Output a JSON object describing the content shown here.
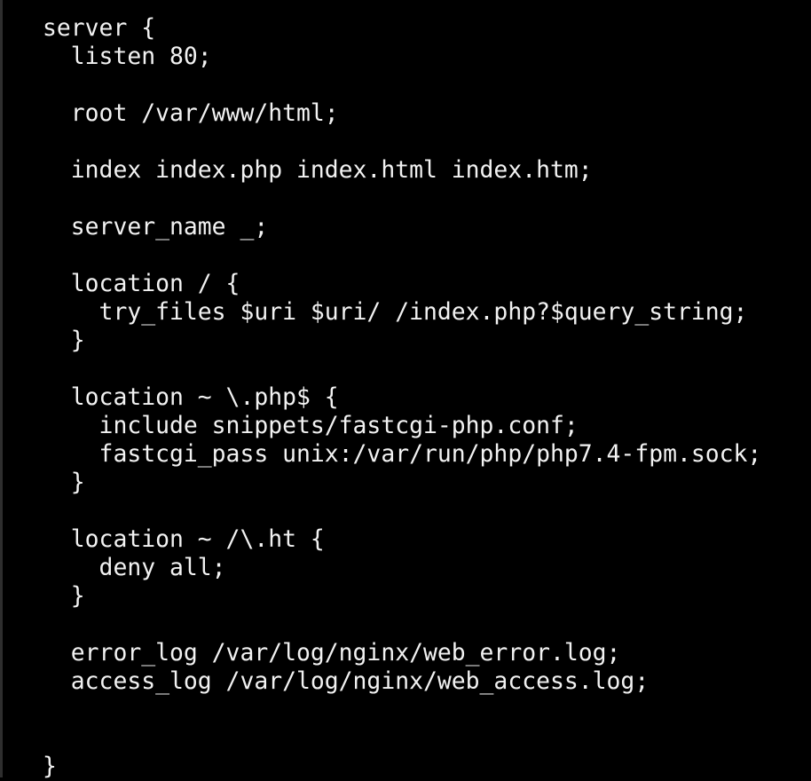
{
  "terminal": {
    "lines": [
      "server {",
      "  listen 80;",
      "",
      "  root /var/www/html;",
      "",
      "  index index.php index.html index.htm;",
      "",
      "  server_name _;",
      "",
      "  location / {",
      "    try_files $uri $uri/ /index.php?$query_string;",
      "  }",
      "",
      "  location ~ \\.php$ {",
      "    include snippets/fastcgi-php.conf;",
      "    fastcgi_pass unix:/var/run/php/php7.4-fpm.sock;",
      "  }",
      "",
      "  location ~ /\\.ht {",
      "    deny all;",
      "  }",
      "",
      "  error_log /var/log/nginx/web_error.log;",
      "  access_log /var/log/nginx/web_access.log;",
      "",
      "",
      "}"
    ]
  }
}
